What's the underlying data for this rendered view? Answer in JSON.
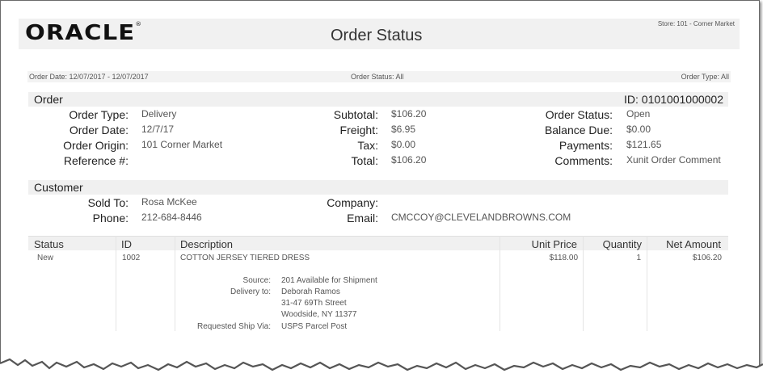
{
  "header": {
    "logo_text": "ORACLE",
    "title": "Order Status",
    "store": "Store: 101 - Corner Market"
  },
  "filters": {
    "order_date": "Order Date: 12/07/2017 - 12/07/2017",
    "order_status": "Order Status: All",
    "order_type": "Order Type: All"
  },
  "order": {
    "section_label": "Order",
    "id": "ID: 0101001000002",
    "fields": {
      "order_type_label": "Order Type:",
      "order_type": "Delivery",
      "order_date_label": "Order Date:",
      "order_date": "12/7/17",
      "order_origin_label": "Order Origin:",
      "order_origin": "101 Corner Market",
      "reference_label": "Reference #:",
      "reference": "",
      "subtotal_label": "Subtotal:",
      "subtotal": "$106.20",
      "freight_label": "Freight:",
      "freight": "$6.95",
      "tax_label": "Tax:",
      "tax": "$0.00",
      "total_label": "Total:",
      "total": "$106.20",
      "order_status_label": "Order Status:",
      "order_status": "Open",
      "balance_due_label": "Balance Due:",
      "balance_due": "$0.00",
      "payments_label": "Payments:",
      "payments": "$121.65",
      "comments_label": "Comments:",
      "comments": "Xunit Order Comment"
    }
  },
  "customer": {
    "section_label": "Customer",
    "sold_to_label": "Sold To:",
    "sold_to": "Rosa McKee",
    "phone_label": "Phone:",
    "phone": "212-684-8446",
    "company_label": "Company:",
    "company": "",
    "email_label": "Email:",
    "email": "CMCCOY@CLEVELANDBROWNS.COM"
  },
  "items": {
    "columns": [
      "Status",
      "ID",
      "Description",
      "Unit Price",
      "Quantity",
      "Net Amount"
    ],
    "rows": [
      {
        "status": "New",
        "id": "1002",
        "description": "COTTON JERSEY TIERED DRESS",
        "unit_price": "$118.00",
        "quantity": "1",
        "net_amount": "$106.20",
        "source_label": "Source:",
        "source": "201 Available for Shipment",
        "delivery_label": "Delivery to:",
        "delivery_name": "Deborah Ramos",
        "delivery_street": "31-47 69Th Street",
        "delivery_city": "Woodside, NY 11377",
        "ship_via_label": "Requested Ship Via:",
        "ship_via": "USPS Parcel Post"
      }
    ]
  }
}
